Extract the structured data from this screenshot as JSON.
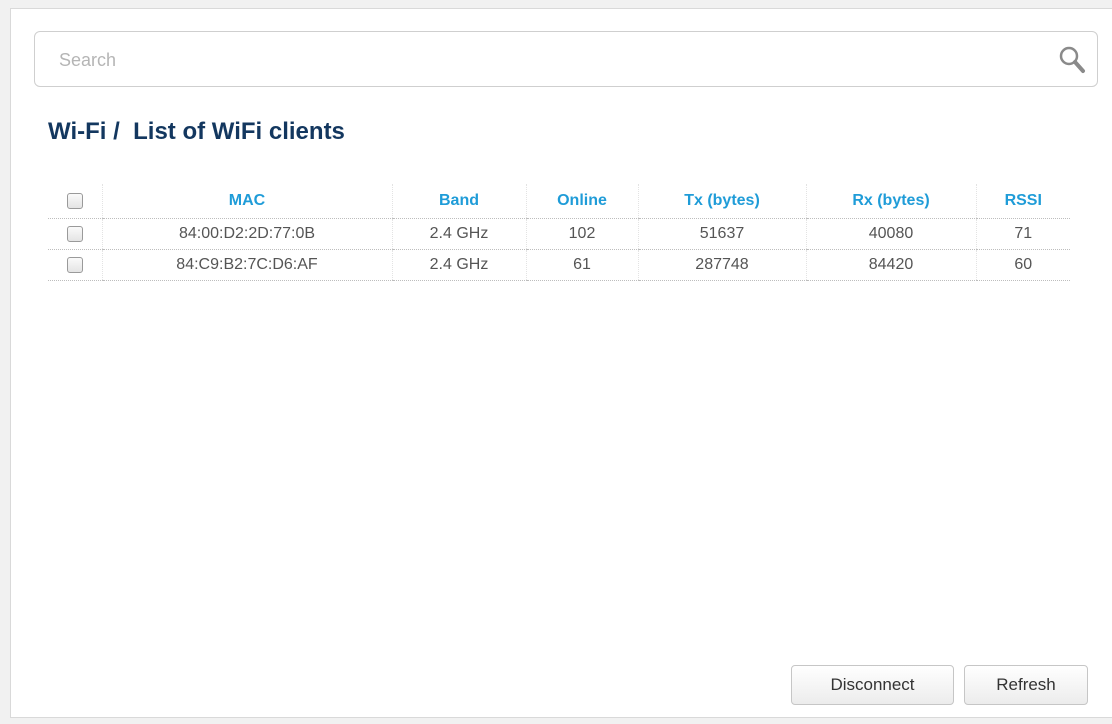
{
  "search": {
    "placeholder": "Search",
    "value": ""
  },
  "breadcrumb": {
    "section": "Wi-Fi /",
    "page": "List of WiFi clients"
  },
  "table": {
    "columns": [
      "MAC",
      "Band",
      "Online",
      "Tx (bytes)",
      "Rx (bytes)",
      "RSSI"
    ],
    "rows": [
      {
        "mac": "84:00:D2:2D:77:0B",
        "band": "2.4 GHz",
        "online": "102",
        "tx": "51637",
        "rx": "40080",
        "rssi": "71",
        "selected": false
      },
      {
        "mac": "84:C9:B2:7C:D6:AF",
        "band": "2.4 GHz",
        "online": "61",
        "tx": "287748",
        "rx": "84420",
        "rssi": "60",
        "selected": false
      }
    ]
  },
  "buttons": {
    "disconnect": "Disconnect",
    "refresh": "Refresh"
  },
  "colors": {
    "title": "#13375f",
    "header_text": "#1f9cd8",
    "cell_text": "#555555"
  }
}
